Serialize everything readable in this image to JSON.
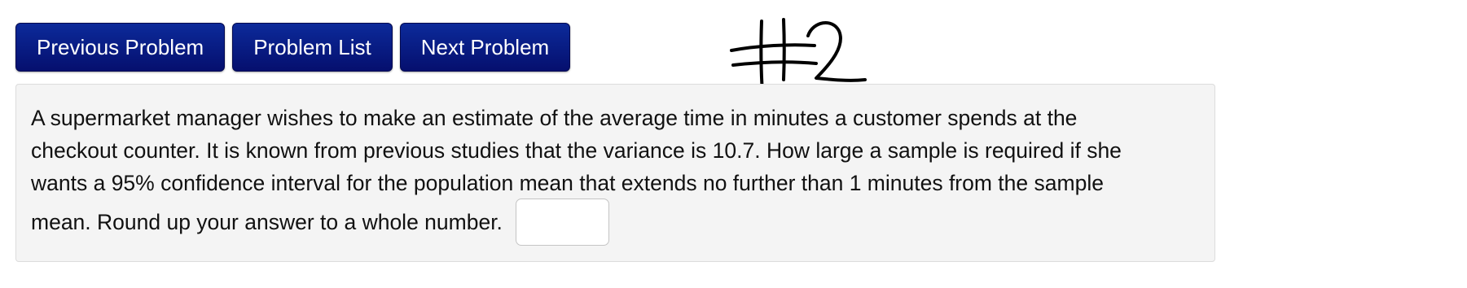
{
  "nav": {
    "previous_label": "Previous Problem",
    "list_label": "Problem List",
    "next_label": "Next Problem"
  },
  "annotation": {
    "handwritten": "#2"
  },
  "problem": {
    "text_lines": [
      "A supermarket manager wishes to make an estimate of the average time in minutes a customer spends at the",
      "checkout counter. It is known from previous studies that the variance is 10.7. How large a sample is required if she",
      "wants a 95% confidence interval for the population mean that extends no further than 1 minutes from the sample"
    ],
    "last_line": "mean. Round up your answer to a whole number.",
    "answer_value": ""
  },
  "colors": {
    "button_bg": "#0a1f8a",
    "button_text": "#ffffff",
    "panel_bg": "#f4f4f4"
  }
}
